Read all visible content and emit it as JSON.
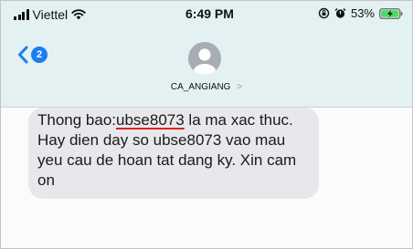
{
  "status_bar": {
    "carrier": "Viettel",
    "time": "6:49 PM",
    "battery": "53%"
  },
  "nav": {
    "badge_count": "2"
  },
  "contact": {
    "name": "CA_ANGIANG",
    "chevron": ">"
  },
  "message": {
    "prefix": "Thong bao:",
    "code": "ubse8073",
    "body": " la ma xac thuc. Hay dien day so ubse8073 vao mau yeu cau de hoan tat dang ky. Xin cam on"
  },
  "colors": {
    "header_bg": "#e4f1f2",
    "accent": "#1a7ff0",
    "bubble_bg": "#e8e8ec",
    "underline": "#e02020",
    "battery_fill": "#4cd964"
  },
  "icons": [
    "signal-icon",
    "wifi-icon",
    "lock-rotation-icon",
    "alarm-icon",
    "battery-charging-icon",
    "back-chevron-icon",
    "avatar-person-icon",
    "chevron-right-icon"
  ]
}
